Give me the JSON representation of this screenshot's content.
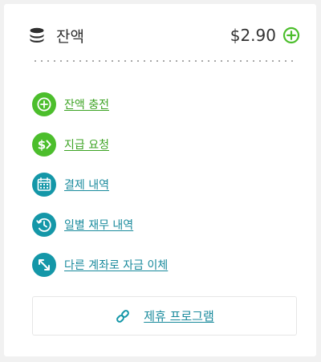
{
  "balance": {
    "title": "잔액",
    "amount": "$2.90",
    "icon": "coins-icon",
    "add_icon": "plus-circle-icon"
  },
  "menu": [
    {
      "label": "잔액 충전",
      "icon": "plus-circle-icon",
      "color": "#4cbe2c"
    },
    {
      "label": "지급 요청",
      "icon": "dollar-transfer-icon",
      "color": "#4cbe2c"
    },
    {
      "label": "결제 내역",
      "icon": "calendar-icon",
      "color": "#1497a8"
    },
    {
      "label": "일별 재무 내역",
      "icon": "history-clock-icon",
      "color": "#1497a8"
    },
    {
      "label": "다른 계좌로 자금 이체",
      "icon": "transfer-arrows-icon",
      "color": "#1497a8"
    }
  ],
  "partner": {
    "label": "제휴 프로그램",
    "icon": "link-icon"
  },
  "colors": {
    "accent_green": "#4cbe2c",
    "accent_teal": "#1497a8"
  }
}
